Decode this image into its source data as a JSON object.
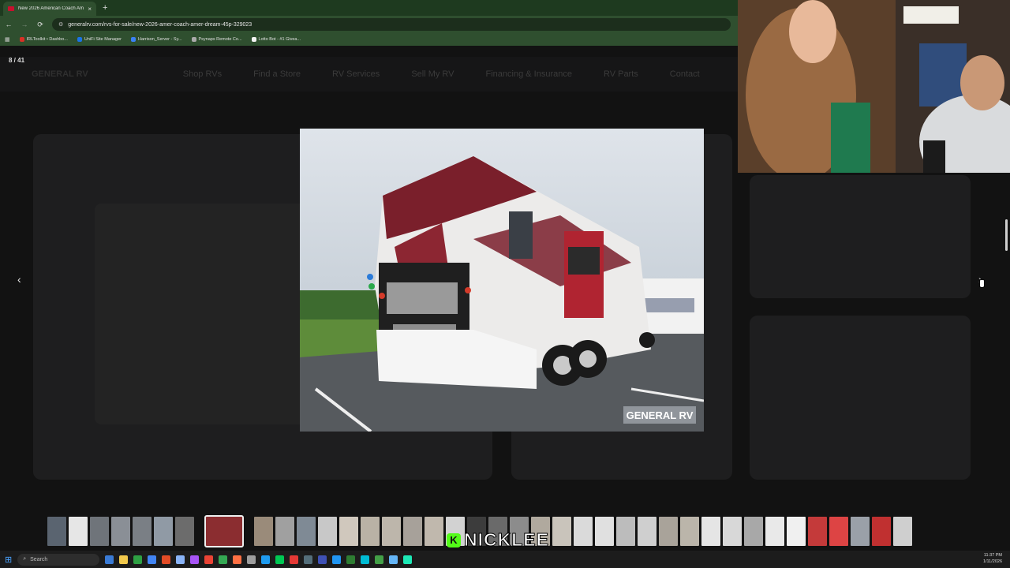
{
  "browser": {
    "tab_title": "New 2026 American Coach Am",
    "tab_close": "×",
    "new_tab": "+",
    "back": "←",
    "forward": "→",
    "reload": "⟳",
    "url": "generalrv.com/rvs-for-sale/new-2026-amer-coach-amer-dream-45p-329023",
    "bookmarks": [
      {
        "label": "IRLToolkit • Dashbo...",
        "color": "#d93025"
      },
      {
        "label": "UniFi Site Manager",
        "color": "#1a73e8"
      },
      {
        "label": "Harrison_Server - Sy...",
        "color": "#3b82f6"
      },
      {
        "label": "Psynaps Remote Co...",
        "color": "#aaaaaa"
      },
      {
        "label": "Lotto Bot - #1 Givea...",
        "color": "#f4f4f4"
      }
    ]
  },
  "gallery": {
    "counter": "8 / 41",
    "prev_icon": "‹",
    "next_icon": "›",
    "watermark": "GENERAL RV",
    "thumb_colors": [
      "#5a6470",
      "#e6e6e6",
      "#6f747a",
      "#8a8f96",
      "#7a7f85",
      "#909aa5",
      "#6c6c6c",
      "#8b2d30",
      "#9a8b7a",
      "#a0a0a0",
      "#7f8a95",
      "#c8c8c8",
      "#d0c8bd",
      "#b9b2a5",
      "#bdb6ab",
      "#a7a19a",
      "#c0b8ad",
      "#d2d2d2",
      "#3c3c3c",
      "#6a6a6a",
      "#8c8c8c",
      "#b0a99e",
      "#c9c4bb",
      "#dadada",
      "#e0e0e0",
      "#bcbcbc",
      "#cfcfcf",
      "#a9a39a",
      "#bbb5aa",
      "#e5e5e5",
      "#d8d8d8",
      "#a8a8a8",
      "#e9e9e9",
      "#f0f0f0",
      "#c43a3a",
      "#d44",
      "#9aa0a8",
      "#c03030",
      "#cfcfcf"
    ]
  },
  "site_nav": {
    "logo": "GENERAL RV",
    "items": [
      "Shop RVs",
      "Find a Store",
      "RV Services",
      "Sell My RV",
      "Financing & Insurance",
      "RV Parts",
      "Contact"
    ]
  },
  "overlay": {
    "k_letter": "K",
    "name": "NICKLEE"
  },
  "taskbar": {
    "search_placeholder": "Search",
    "time": "11:37 PM",
    "date": "1/11/2026",
    "app_colors": [
      "#3a7bd5",
      "#f2c94c",
      "#2ea043",
      "#4285f4",
      "#e34c26",
      "#8ab4f8",
      "#a855f7",
      "#ea4335",
      "#34a853",
      "#ff7043",
      "#9e9e9e",
      "#1f9cf0",
      "#00c853",
      "#e53935",
      "#546e7a",
      "#3f51b5",
      "#2196f3",
      "#2e7d32",
      "#00bcd4",
      "#43a047",
      "#64b5f6",
      "#1de9b6"
    ]
  },
  "colors": {
    "browser_chrome": "#2f4f2f",
    "accent_green": "#53fc18",
    "rv_maroon": "#7a1f2b"
  }
}
